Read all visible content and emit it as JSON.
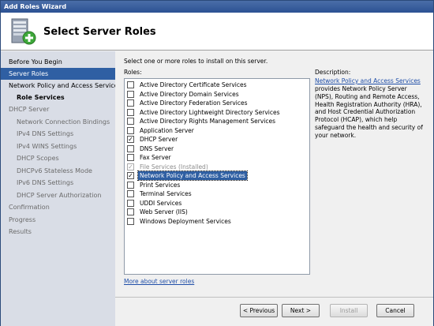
{
  "window": {
    "title": "Add Roles Wizard"
  },
  "header": {
    "title": "Select Server Roles"
  },
  "sidebar": {
    "items": [
      {
        "label": "Before You Begin"
      },
      {
        "label": "Server Roles"
      },
      {
        "label": "Network Policy and Access Services"
      },
      {
        "label": "Role Services"
      },
      {
        "label": "DHCP Server"
      },
      {
        "label": "Network Connection Bindings"
      },
      {
        "label": "IPv4 DNS Settings"
      },
      {
        "label": "IPv4 WINS Settings"
      },
      {
        "label": "DHCP Scopes"
      },
      {
        "label": "DHCPv6 Stateless Mode"
      },
      {
        "label": "IPv6 DNS Settings"
      },
      {
        "label": "DHCP Server Authorization"
      },
      {
        "label": "Confirmation"
      },
      {
        "label": "Progress"
      },
      {
        "label": "Results"
      }
    ]
  },
  "main": {
    "instruction": "Select one or more roles to install on this server.",
    "roles_label": "Roles:",
    "roles": [
      {
        "label": "Active Directory Certificate Services",
        "checked": false
      },
      {
        "label": "Active Directory Domain Services",
        "checked": false
      },
      {
        "label": "Active Directory Federation Services",
        "checked": false
      },
      {
        "label": "Active Directory Lightweight Directory Services",
        "checked": false
      },
      {
        "label": "Active Directory Rights Management Services",
        "checked": false
      },
      {
        "label": "Application Server",
        "checked": false
      },
      {
        "label": "DHCP Server",
        "checked": true
      },
      {
        "label": "DNS Server",
        "checked": false
      },
      {
        "label": "Fax Server",
        "checked": false
      },
      {
        "label": "File Services  (Installed)",
        "checked": true,
        "disabled": true
      },
      {
        "label": "Network Policy and Access Services",
        "checked": true,
        "selected": true
      },
      {
        "label": "Print Services",
        "checked": false
      },
      {
        "label": "Terminal Services",
        "checked": false
      },
      {
        "label": "UDDI Services",
        "checked": false
      },
      {
        "label": "Web Server (IIS)",
        "checked": false
      },
      {
        "label": "Windows Deployment Services",
        "checked": false
      }
    ],
    "description_label": "Description:",
    "description_link": "Network Policy and Access Services",
    "description_text": "provides Network Policy Server (NPS), Routing and Remote Access, Health Registration Authority (HRA), and Host Credential Authorization Protocol (HCAP), which help safeguard the health and security of your network.",
    "more_link": "More about server roles"
  },
  "footer": {
    "previous_label": "< Previous",
    "next_label": "Next >",
    "install_label": "Install",
    "cancel_label": "Cancel"
  },
  "check_mark": "✓"
}
